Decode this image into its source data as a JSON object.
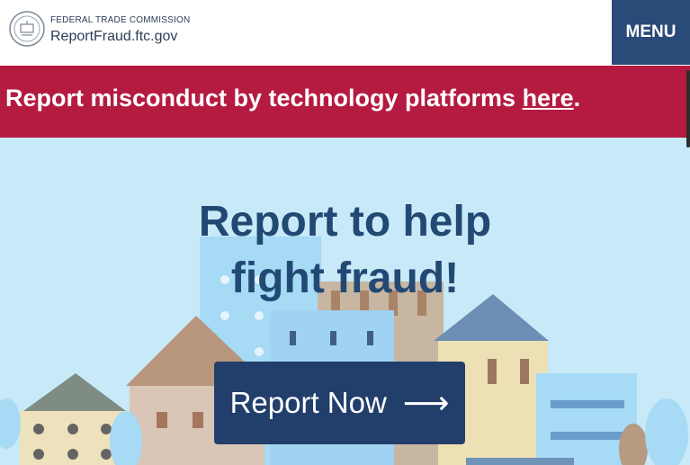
{
  "header": {
    "agency": "FEDERAL TRADE COMMISSION",
    "site": "ReportFraud.ftc.gov",
    "menu_label": "MENU"
  },
  "banner": {
    "text": "Report misconduct by technology platforms ",
    "link": "here",
    "trailing": "."
  },
  "hero": {
    "title_line1": "Report to help",
    "title_line2": "fight fraud!",
    "cta_label": "Report Now",
    "cta_arrow": "⟶"
  },
  "colors": {
    "navy": "#223f6b",
    "banner_red": "#b51a40",
    "sky": "#c8e9f8"
  },
  "icons": [
    "ftc-seal-icon",
    "arrow-right-icon"
  ]
}
